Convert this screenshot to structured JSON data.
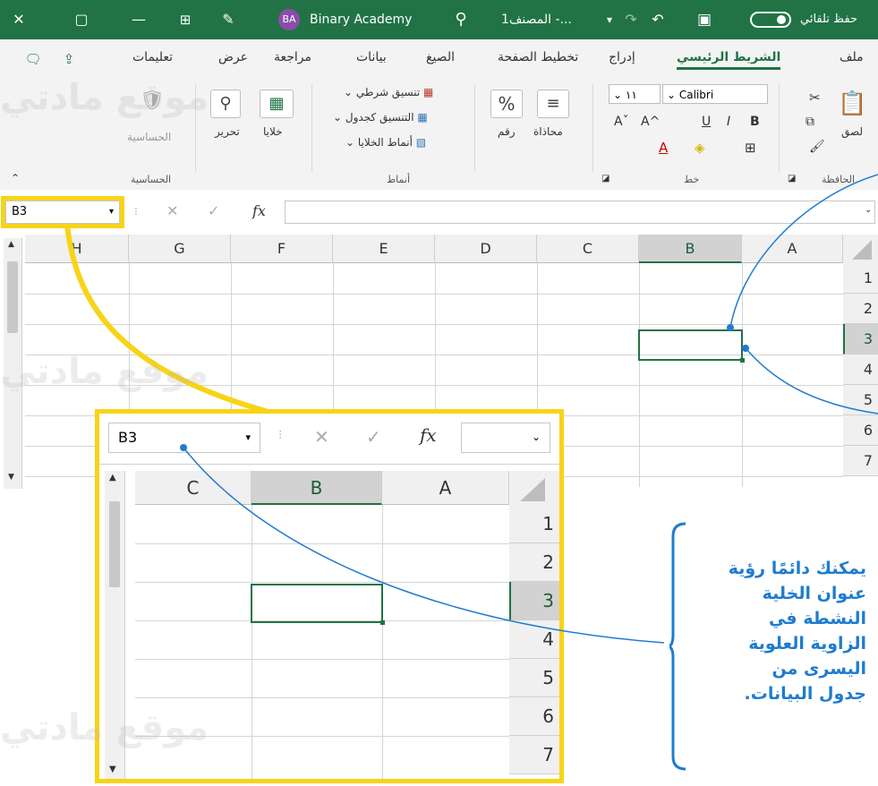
{
  "titlebar": {
    "autosave_label": "حفظ تلقائي",
    "save_icon": "save-icon",
    "file_name": "المصنف1 -...",
    "search_icon": "search-icon",
    "user_initials": "BA",
    "user_name": "Binary Academy",
    "minimize": "—",
    "restore": "▢",
    "close": "✕",
    "accent": "#217346"
  },
  "tabs": [
    {
      "label": "ملف"
    },
    {
      "label": "الشريط الرئيسي",
      "active": true
    },
    {
      "label": "إدراج"
    },
    {
      "label": "تخطيط الصفحة"
    },
    {
      "label": "الصيغ"
    },
    {
      "label": "بيانات"
    },
    {
      "label": "مراجعة"
    },
    {
      "label": "عرض"
    },
    {
      "label": "تعليمات"
    }
  ],
  "ribbon": {
    "clipboard": {
      "paste": "لصق",
      "group": "الحافظة"
    },
    "font": {
      "name": "Calibri",
      "size": "١١",
      "bold": "B",
      "italic": "I",
      "underline": "U",
      "grow": "A^",
      "shrink": "Aˇ",
      "group": "خط"
    },
    "alignment": {
      "label": "محاذاة"
    },
    "number": {
      "symbol": "%",
      "label": "رقم"
    },
    "styles": {
      "conditional": "تنسيق شرطي",
      "table": "التنسيق كجدول",
      "cell_styles": "أنماط الخلايا",
      "group": "أنماط"
    },
    "cells": {
      "label": "خلايا"
    },
    "editing": {
      "label": "تحرير"
    },
    "sensitivity": {
      "label": "الحساسية",
      "group": "الحساسية"
    }
  },
  "formula_bar": {
    "name_box": "B3",
    "cancel": "✕",
    "enter": "✓",
    "fx": "fx"
  },
  "sheet": {
    "columns": [
      "A",
      "B",
      "C",
      "D",
      "E",
      "F",
      "G",
      "H"
    ],
    "rows": [
      "1",
      "2",
      "3",
      "4",
      "5",
      "6",
      "7"
    ],
    "active_column": "B",
    "active_row": "3"
  },
  "zoom": {
    "name_box": "B3",
    "fx": "fx",
    "columns": [
      "A",
      "B",
      "C"
    ],
    "rows": [
      "1",
      "2",
      "3",
      "4",
      "5",
      "6",
      "7"
    ]
  },
  "callout": {
    "line1": "يمكنك دائمًا رؤية",
    "line2": "عنوان الخلية",
    "line3": "النشطة في",
    "line4": "الزاوية العلوية",
    "line5": "اليسرى من",
    "line6": "جدول البيانات.",
    "color": "#1e7ccf"
  },
  "watermark": "موقع مادتي"
}
